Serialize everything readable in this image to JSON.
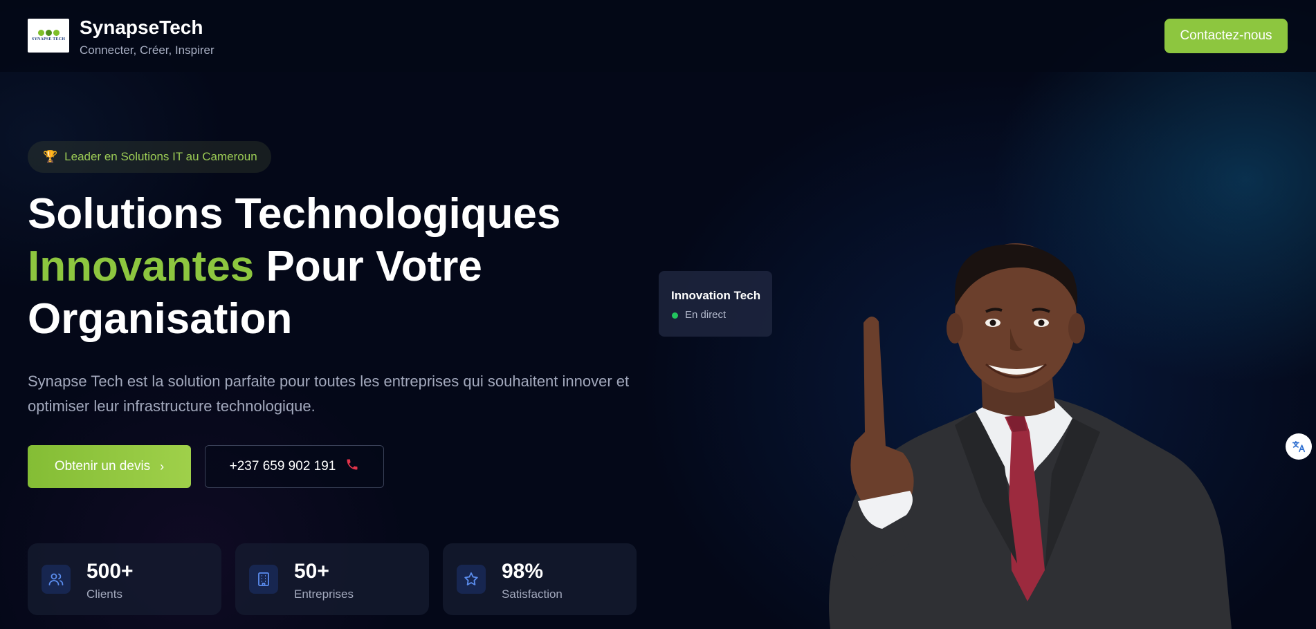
{
  "header": {
    "logo_text": "SYNAPSE TECH",
    "brand_name": "SynapseTech",
    "tagline": "Connecter, Créer, Inspirer",
    "contact_label": "Contactez-nous"
  },
  "hero": {
    "badge_icon": "trophy-icon",
    "badge_text": "Leader en Solutions IT au Cameroun",
    "title_line1": "Solutions Technologiques",
    "title_accent": "Innovantes",
    "title_rest": " Pour Votre",
    "title_line3": "Organisation",
    "description": "Synapse Tech est la solution parfaite pour toutes les entreprises qui souhaitent innover et optimiser leur infrastructure technologique.",
    "quote_button": "Obtenir un devis",
    "phone_button": "+237 659 902 191"
  },
  "stats": [
    {
      "icon": "users-icon",
      "value": "500+",
      "label": "Clients"
    },
    {
      "icon": "building-icon",
      "value": "50+",
      "label": "Entreprises"
    },
    {
      "icon": "star-icon",
      "value": "98%",
      "label": "Satisfaction"
    }
  ],
  "live_card": {
    "title": "Innovation Tech",
    "status": "En direct"
  },
  "colors": {
    "accent": "#8dc63f",
    "background": "#040818",
    "live_dot": "#22c55e",
    "phone_icon": "#e2344a"
  }
}
